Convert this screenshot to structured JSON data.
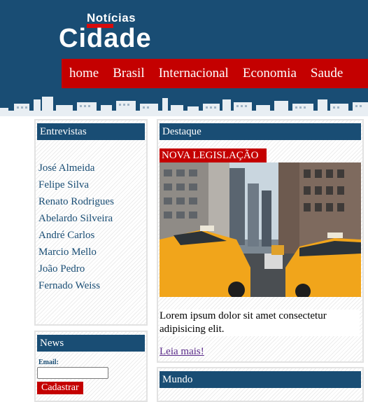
{
  "header": {
    "logo_top": "Notícias",
    "logo_main": "Cidade"
  },
  "nav": {
    "items": [
      "home",
      "Brasil",
      "Internacional",
      "Economia",
      "Saude"
    ]
  },
  "sidebar": {
    "interviews": {
      "title": "Entrevistas",
      "names": [
        "José Almeida",
        "Felipe Silva",
        "Renato Rodrigues",
        "Abelardo Silveira",
        "André Carlos",
        "Marcio Mello",
        "João Pedro",
        "Fernado Weiss"
      ]
    },
    "news": {
      "title": "News",
      "email_label": "Email:",
      "email_value": "",
      "button_label": "Cadastrar"
    }
  },
  "main": {
    "highlight": {
      "title": "Destaque",
      "badge": "NOVA LEGISLAÇÃO",
      "text": "Lorem ipsum dolor sit amet consectetur adipisicing elit.",
      "link": "Leia mais!"
    },
    "world": {
      "title": "Mundo"
    }
  },
  "colors": {
    "header_bg": "#194d74",
    "accent_red": "#c40000",
    "link_visited": "#5a2a8a"
  }
}
